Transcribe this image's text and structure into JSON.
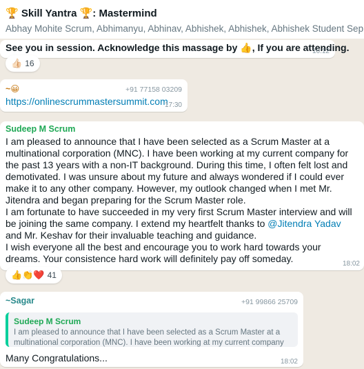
{
  "chat": {
    "title": "🏆 Skill Yantra 🏆: Mastermind",
    "members": "Abhay Mohite Scrum, Abhimanyu, Abhinav, Abhishek, Abhishek, Abhishek Student Sep Morning"
  },
  "messages": {
    "m1": {
      "text_prefix": "See you in session.  Acknowledge this massage by ",
      "thumb": "👍",
      "text_suffix": ", If you are attending.",
      "time": "16:12",
      "reaction_emoji": "👍🏻",
      "reaction_count": "16"
    },
    "m2": {
      "sender": "~😀",
      "phone": "+91 77158 03209",
      "link": "https://onlinescrummastersummit.com",
      "time": "17:30"
    },
    "m3": {
      "sender": "Sudeep M Scrum",
      "p1": "I am pleased to announce that I have been selected as a Scrum Master at a multinational corporation (MNC). I have been working at my current company for the past 13 years with a non-IT background. During this time, I often felt lost and demotivated. I was unsure about my future and always wondered if I could ever make it to any other company. However, my outlook changed when I met Mr. Jitendra and began preparing for the Scrum Master role.",
      "p2a": "I am fortunate to have succeeded in my very first Scrum Master interview and will be joining the same company. I extend my heartfelt thanks to ",
      "mention": "@Jitendra Yadav",
      "p2b": "  and Mr. Keshav for their invaluable teaching and guidance.",
      "p3": "I wish everyone all the best and encourage you to work hard towards your dreams. Your consistence hard work will definitely pay off someday.",
      "time": "18:02",
      "reaction_emoji": "👍👏❤️",
      "reaction_count": "41"
    },
    "m4": {
      "sender": "~Sagar",
      "phone": "+91 99866 25709",
      "quote_sender": "Sudeep M Scrum",
      "quote_text": "I am pleased to announce that I have been selected as a Scrum Master at a multinational corporation (MNC). I have been working at my current company for t...",
      "text": "Many Congratulations...",
      "time": "18:02"
    }
  },
  "colors": {
    "background": "#efeae2",
    "sudeep_name": "#1fa855",
    "sagar_name": "#2a8a8c",
    "emoji_sender": "#c77d1c",
    "link": "#027eb5"
  }
}
